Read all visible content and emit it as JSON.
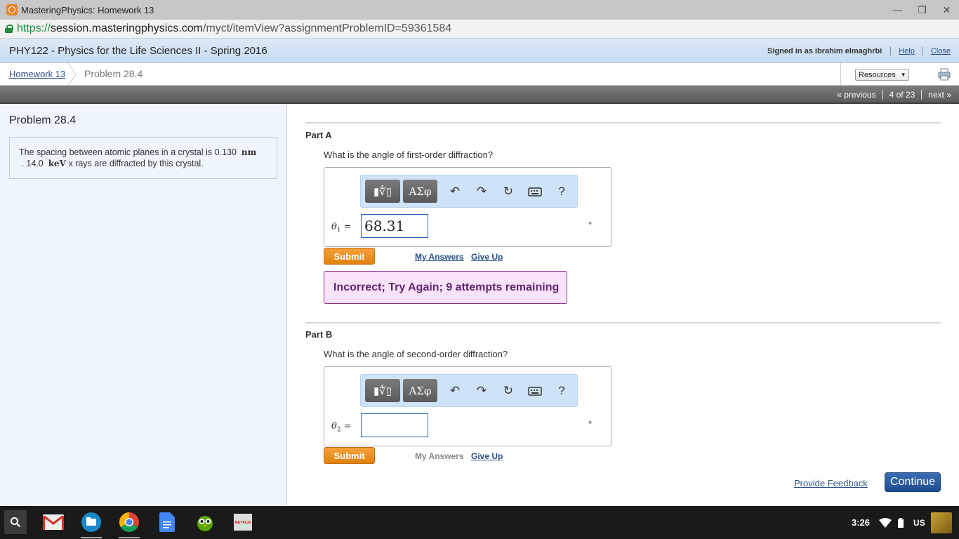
{
  "window": {
    "title": "MasteringPhysics: Homework 13",
    "minimize_glyph": "—",
    "restore_glyph": "❐",
    "close_glyph": "✕"
  },
  "urlbar": {
    "scheme": "https://",
    "host": "session.masteringphysics.com",
    "path": "/myct/itemView?assignmentProblemID=59361584"
  },
  "header": {
    "course": "PHY122 - Physics for the Life Sciences II - Spring 2016",
    "signed_in": "Signed in as ibrahim elmaghrbi",
    "help": "Help",
    "close": "Close"
  },
  "breadcrumb": {
    "home": "Homework 13",
    "current": "Problem 28.4",
    "resources": "Resources"
  },
  "nav": {
    "previous": "« previous",
    "position": "4 of 23",
    "next": "next »"
  },
  "problem": {
    "title": "Problem 28.4",
    "text_part1": "The spacing between atomic planes in a crystal is 0.130",
    "unit1": "nm",
    "text_part2": ". 14.0",
    "unit2": "keV",
    "text_part3": "x rays are diffracted by this crystal."
  },
  "toolbar": {
    "templates_label": "▮∜▯",
    "symbols_label": "ΑΣφ",
    "help_label": "?"
  },
  "part_a": {
    "title": "Part A",
    "question": "What is the angle of first-order diffraction?",
    "var": "θ",
    "sub": "1",
    "equals": "=",
    "value": "68.31",
    "unit": "°",
    "submit": "Submit",
    "my_answers": "My Answers",
    "give_up": "Give Up",
    "feedback": "Incorrect; Try Again; 9 attempts remaining"
  },
  "part_b": {
    "title": "Part B",
    "question": "What is the angle of second-order diffraction?",
    "var": "θ",
    "sub": "2",
    "equals": "=",
    "value": "",
    "unit": "°",
    "submit": "Submit",
    "my_answers": "My Answers",
    "give_up": "Give Up"
  },
  "footer": {
    "provide_feedback": "Provide Feedback",
    "continue": "Continue"
  },
  "taskbar": {
    "apps": [
      "gmail-icon",
      "files-icon",
      "chrome-icon",
      "docs-icon",
      "duolingo-icon",
      "netflix-icon"
    ],
    "netflix_text": "NETFLIX",
    "clock": "3:26",
    "keyboard_layout": "US"
  },
  "colors": {
    "accent_blue": "#2a4f8a",
    "submit_orange": "#e8911f",
    "feedback_bg": "#fbe2fb",
    "feedback_border": "#8b2f8b",
    "continue_blue": "#2a5ca3"
  }
}
